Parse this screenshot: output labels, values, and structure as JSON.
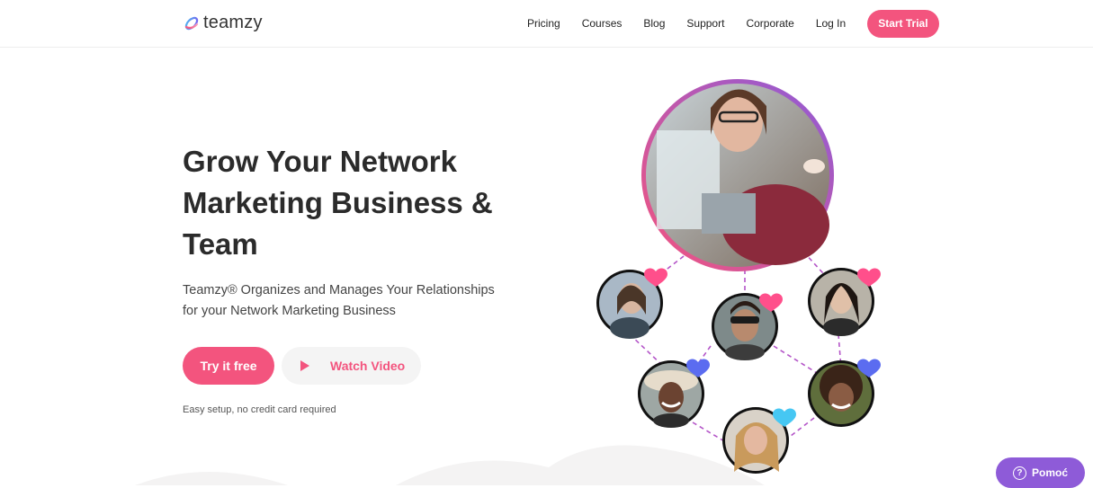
{
  "header": {
    "logo_text": "teamzy",
    "nav": [
      "Pricing",
      "Courses",
      "Blog",
      "Support",
      "Corporate",
      "Log In"
    ],
    "cta": "Start Trial"
  },
  "hero": {
    "title_lines": [
      "Grow Your Network",
      "Marketing Business &",
      "Team"
    ],
    "subtitle_lines": [
      "Teamzy® Organizes and Manages Your Relationships",
      "for your Network Marketing Business"
    ],
    "primary_button": "Try it free",
    "secondary_button": "Watch Video",
    "note": "Easy setup, no credit card required"
  },
  "help": {
    "label": "Pomoć"
  },
  "colors": {
    "accent": "#f3547e",
    "purple": "#8e5bd8",
    "heart_pink": "#ff4f8b",
    "heart_blue": "#5b6cf0",
    "heart_cyan": "#46c7f3"
  }
}
